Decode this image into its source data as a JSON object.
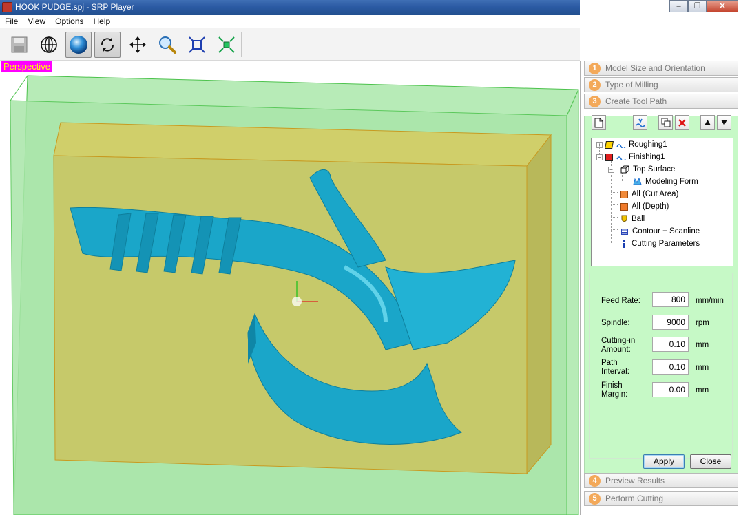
{
  "window": {
    "title": "HOOK PUDGE.spj - SRP Player",
    "controls": [
      "–",
      "❐",
      "✕"
    ]
  },
  "menu": [
    "File",
    "View",
    "Options",
    "Help"
  ],
  "toolbar": {
    "tools": [
      "save-icon",
      "globe-icon",
      "sphere-icon",
      "rotate-icon",
      "pan-icon",
      "zoom-icon",
      "fit-icon",
      "center-icon"
    ],
    "active_tools": [
      "sphere-icon",
      "rotate-icon"
    ]
  },
  "viewport": {
    "label": "Perspective",
    "label_bg": "#ff00ff",
    "label_fg": "#ffff00",
    "stock_color": "#c6c96a",
    "model_color": "#1aa6c9",
    "bounding_box_color": "#a8e8a8"
  },
  "panel": {
    "steps": [
      {
        "num": "1",
        "label": "Model Size and Orientation"
      },
      {
        "num": "2",
        "label": "Type of Milling"
      },
      {
        "num": "3",
        "label": "Create Tool Path"
      },
      {
        "num": "4",
        "label": "Preview Results"
      },
      {
        "num": "5",
        "label": "Perform Cutting"
      }
    ],
    "tree": [
      {
        "label": "Roughing1",
        "icon": "path-icon"
      },
      {
        "label": "Finishing1",
        "icon": "path-icon"
      },
      {
        "label": "Top Surface",
        "icon": "surface-icon"
      },
      {
        "label": "Modeling Form",
        "icon": "form-icon"
      },
      {
        "label": "All (Cut Area)",
        "icon": "area-icon"
      },
      {
        "label": "All (Depth)",
        "icon": "depth-icon"
      },
      {
        "label": "Ball",
        "icon": "ball-tool-icon"
      },
      {
        "label": "Contour + Scanline",
        "icon": "contour-icon"
      },
      {
        "label": "Cutting Parameters",
        "icon": "info-icon"
      }
    ],
    "params": [
      {
        "label": "Feed Rate:",
        "value": "800",
        "unit": "mm/min"
      },
      {
        "label": "Spindle:",
        "value": "9000",
        "unit": "rpm"
      },
      {
        "label": "Cutting-in Amount:",
        "value": "0.10",
        "unit": "mm"
      },
      {
        "label": "Path Interval:",
        "value": "0.10",
        "unit": "mm"
      },
      {
        "label": "Finish Margin:",
        "value": "0.00",
        "unit": "mm"
      }
    ],
    "apply_label": "Apply",
    "close_label": "Close",
    "accent": "#c6f9c6"
  }
}
